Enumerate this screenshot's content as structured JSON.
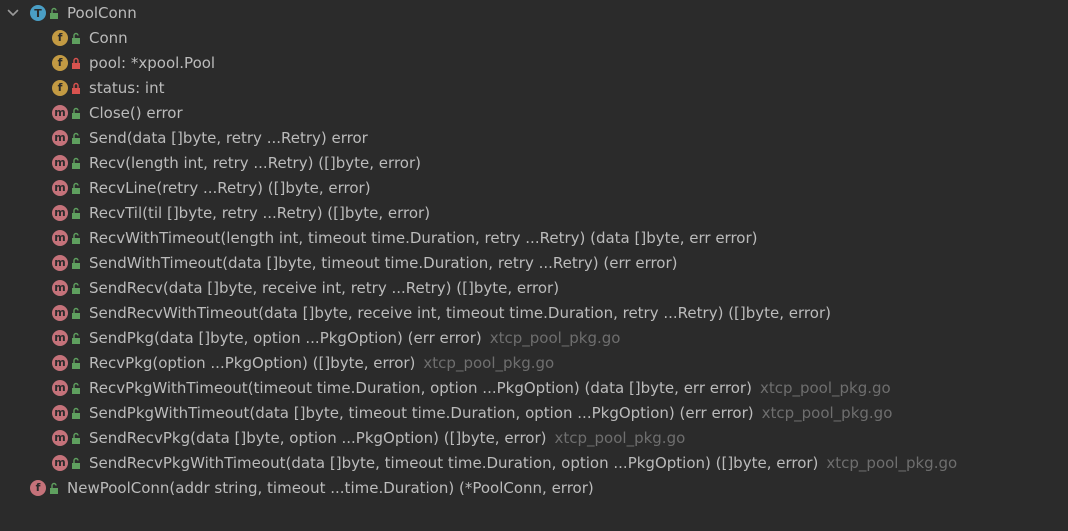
{
  "colors": {
    "background": "#2b2b2b",
    "text": "#bbbbbb",
    "location_text": "#6e6e6e",
    "type_badge": "#4a9ec5",
    "field_badge": "#c39a43",
    "method_badge": "#c5727a",
    "public_icon": "#5fa05f",
    "private_icon": "#d9534f"
  },
  "root": {
    "badge": "T",
    "visibility": "public",
    "label": "PoolConn",
    "expanded": true
  },
  "members": [
    {
      "badge": "f",
      "visibility": "public",
      "label": "Conn",
      "location": ""
    },
    {
      "badge": "f",
      "visibility": "private",
      "label": "pool: *xpool.Pool",
      "location": ""
    },
    {
      "badge": "f",
      "visibility": "private",
      "label": "status: int",
      "location": ""
    },
    {
      "badge": "m",
      "visibility": "public",
      "label": "Close() error",
      "location": ""
    },
    {
      "badge": "m",
      "visibility": "public",
      "label": "Send(data []byte, retry ...Retry) error",
      "location": ""
    },
    {
      "badge": "m",
      "visibility": "public",
      "label": "Recv(length int, retry ...Retry) ([]byte, error)",
      "location": ""
    },
    {
      "badge": "m",
      "visibility": "public",
      "label": "RecvLine(retry ...Retry) ([]byte, error)",
      "location": ""
    },
    {
      "badge": "m",
      "visibility": "public",
      "label": "RecvTil(til []byte, retry ...Retry) ([]byte, error)",
      "location": ""
    },
    {
      "badge": "m",
      "visibility": "public",
      "label": "RecvWithTimeout(length int, timeout time.Duration, retry ...Retry) (data []byte, err error)",
      "location": ""
    },
    {
      "badge": "m",
      "visibility": "public",
      "label": "SendWithTimeout(data []byte, timeout time.Duration, retry ...Retry) (err error)",
      "location": ""
    },
    {
      "badge": "m",
      "visibility": "public",
      "label": "SendRecv(data []byte, receive int, retry ...Retry) ([]byte, error)",
      "location": ""
    },
    {
      "badge": "m",
      "visibility": "public",
      "label": "SendRecvWithTimeout(data []byte, receive int, timeout time.Duration, retry ...Retry) ([]byte, error)",
      "location": ""
    },
    {
      "badge": "m",
      "visibility": "public",
      "label": "SendPkg(data []byte, option ...PkgOption) (err error)",
      "location": "xtcp_pool_pkg.go"
    },
    {
      "badge": "m",
      "visibility": "public",
      "label": "RecvPkg(option ...PkgOption) ([]byte, error)",
      "location": "xtcp_pool_pkg.go"
    },
    {
      "badge": "m",
      "visibility": "public",
      "label": "RecvPkgWithTimeout(timeout time.Duration, option ...PkgOption) (data []byte, err error)",
      "location": "xtcp_pool_pkg.go"
    },
    {
      "badge": "m",
      "visibility": "public",
      "label": "SendPkgWithTimeout(data []byte, timeout time.Duration, option ...PkgOption) (err error)",
      "location": "xtcp_pool_pkg.go"
    },
    {
      "badge": "m",
      "visibility": "public",
      "label": "SendRecvPkg(data []byte, option ...PkgOption) ([]byte, error)",
      "location": "xtcp_pool_pkg.go"
    },
    {
      "badge": "m",
      "visibility": "public",
      "label": "SendRecvPkgWithTimeout(data []byte, timeout time.Duration, option ...PkgOption) ([]byte, error)",
      "location": "xtcp_pool_pkg.go"
    }
  ],
  "functions": [
    {
      "badge": "f",
      "visibility": "public",
      "label": "NewPoolConn(addr string, timeout ...time.Duration) (*PoolConn, error)",
      "location": ""
    }
  ]
}
